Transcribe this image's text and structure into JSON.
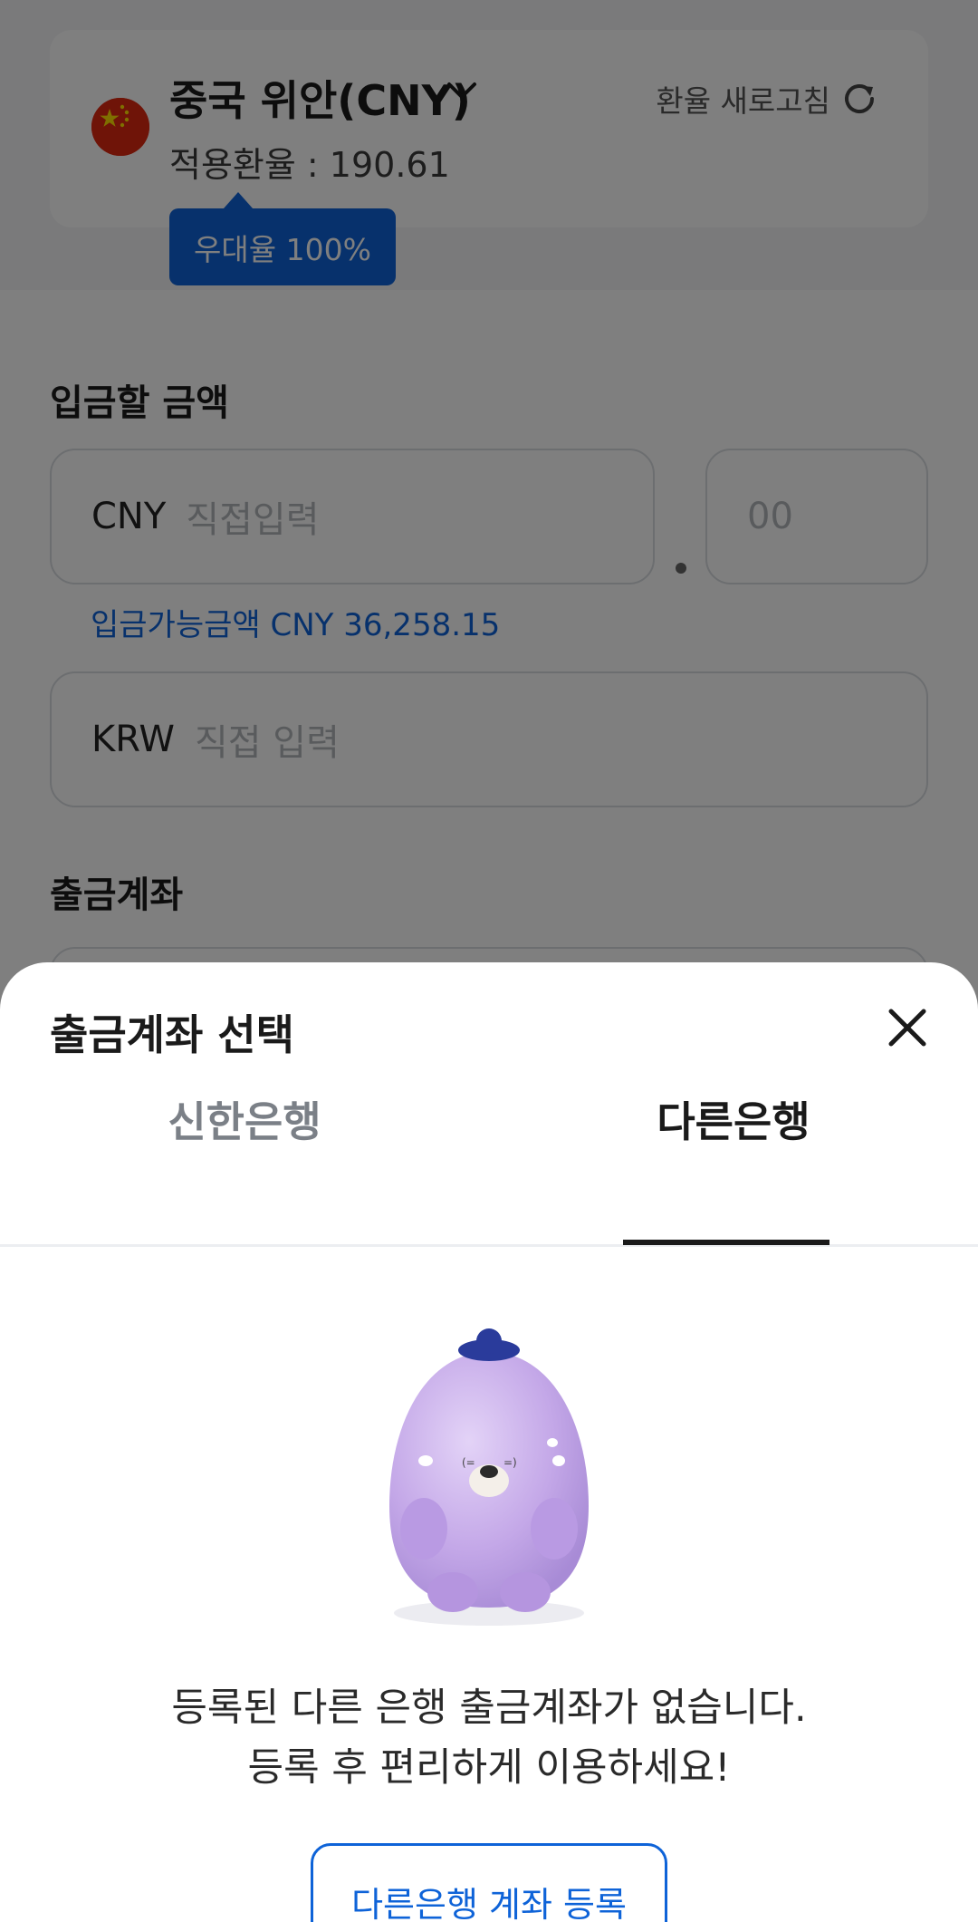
{
  "background": {
    "currency_name": "중국 위안(CNY)",
    "applied_rate": "적용환율 : 190.61",
    "refresh_label": "환율 새로고침",
    "preferential_rate": "우대율 100%",
    "deposit_section_title": "입금할 금액",
    "foreign_input": {
      "currency": "CNY",
      "placeholder": "직접입력"
    },
    "decimal_input": {
      "placeholder": "00"
    },
    "available_amount": "입금가능금액 CNY 36,258.15",
    "krw_input": {
      "currency": "KRW",
      "placeholder": "직접 입력"
    },
    "withdraw_section_title": "출금계좌"
  },
  "sheet": {
    "title": "출금계좌 선택",
    "tabs": [
      {
        "label": "신한은행",
        "selected": false
      },
      {
        "label": "다른은행",
        "selected": true
      }
    ],
    "empty_message_line1": "등록된 다른 은행 출금계좌가 없습니다.",
    "empty_message_line2": "등록 후 편리하게 이용하세요!",
    "register_button": "다른은행 계좌 등록"
  },
  "colors": {
    "accent": "#0e63d8",
    "text_primary": "#1a1a1a",
    "tab_inactive": "#7b8087",
    "mascot": "#c4a8e8",
    "overlay": "rgba(0,0,0,0.5)"
  },
  "icons": [
    "china-flag-icon",
    "chevron-down-icon",
    "refresh-icon",
    "close-icon",
    "mascot-illustration"
  ]
}
